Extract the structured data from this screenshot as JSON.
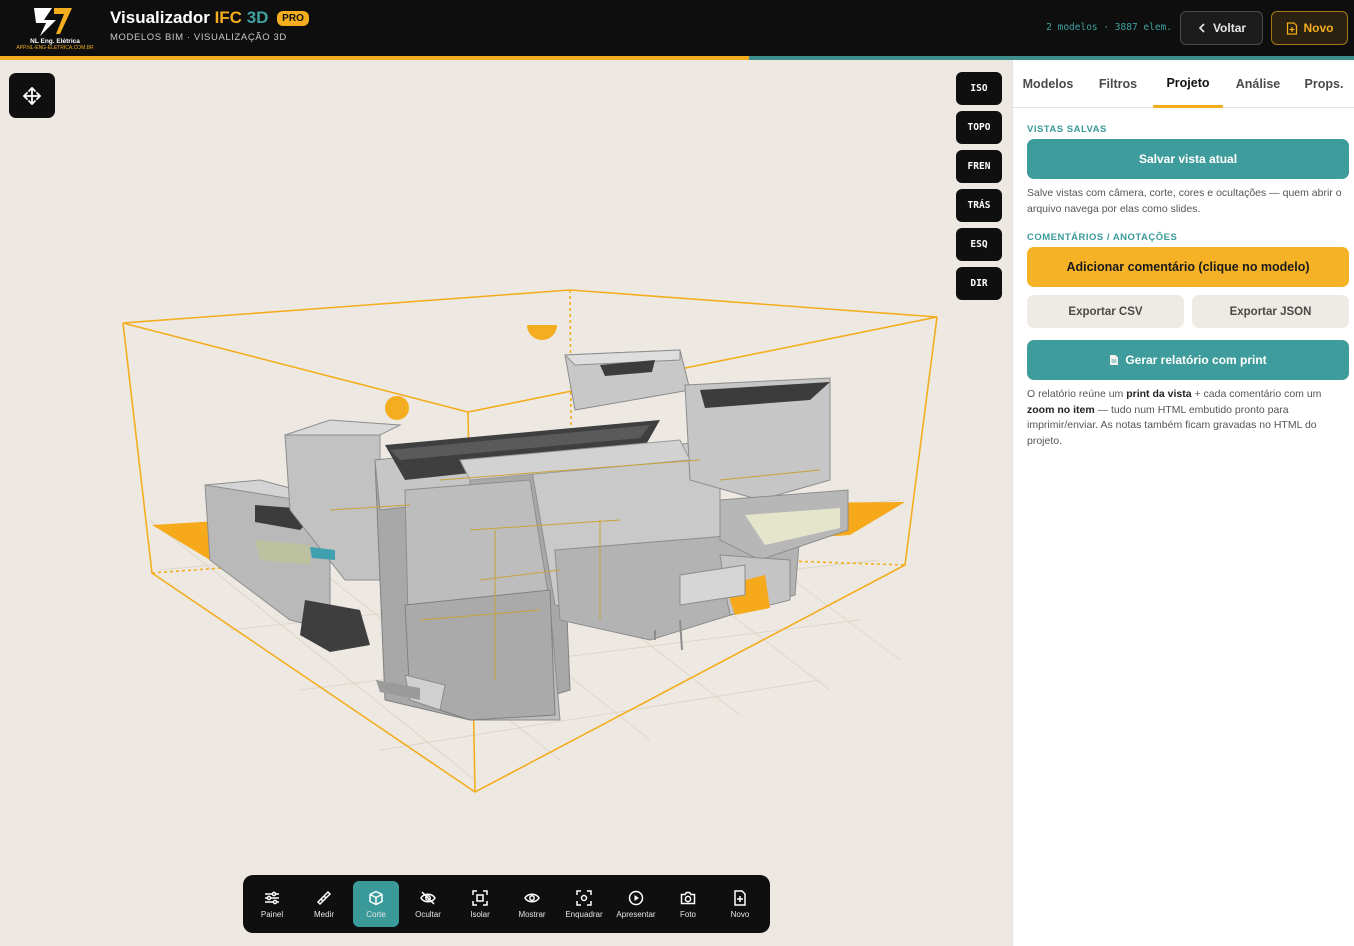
{
  "header": {
    "logo_brand": "NL Eng. Elétrica",
    "logo_url": "APP.NL-ENG-ELETRICA.COM.BR",
    "title_part1": "Visualizador",
    "title_part2": "IFC",
    "title_part3": "3D",
    "badge": "PRO",
    "subtitle": "MODELOS BIM · VISUALIZAÇÃO 3D",
    "stats": "2 modelos · 3887 elem.",
    "back_label": "Voltar",
    "new_label": "Novo",
    "progress_fraction": 0.553
  },
  "view_buttons": [
    "ISO",
    "TOPO",
    "FREN",
    "TRÁS",
    "ESQ",
    "DIR"
  ],
  "toolbar": [
    {
      "label": "Painel",
      "icon": "sliders-icon",
      "active": false
    },
    {
      "label": "Medir",
      "icon": "ruler-icon",
      "active": false
    },
    {
      "label": "Corte",
      "icon": "cube-icon",
      "active": true
    },
    {
      "label": "Ocultar",
      "icon": "eye-off-icon",
      "active": false
    },
    {
      "label": "Isolar",
      "icon": "focus-icon",
      "active": false
    },
    {
      "label": "Mostrar",
      "icon": "eye-icon",
      "active": false
    },
    {
      "label": "Enquadrar",
      "icon": "frame-icon",
      "active": false
    },
    {
      "label": "Apresentar",
      "icon": "play-icon",
      "active": false
    },
    {
      "label": "Foto",
      "icon": "camera-icon",
      "active": false
    },
    {
      "label": "Novo",
      "icon": "file-plus-icon",
      "active": false
    }
  ],
  "panel": {
    "tabs": [
      "Modelos",
      "Filtros",
      "Projeto",
      "Análise",
      "Props."
    ],
    "active_tab": "Projeto",
    "saved_views_title": "VISTAS SALVAS",
    "save_view_button": "Salvar vista atual",
    "saved_views_text": "Salve vistas com câmera, corte, cores e ocultações — quem abrir o arquivo navega por elas como slides.",
    "comments_title": "COMENTÁRIOS / ANOTAÇÕES",
    "add_comment_button": "Adicionar comentário (clique no modelo)",
    "export_csv": "Exportar CSV",
    "export_json": "Exportar JSON",
    "report_button": "Gerar relatório com print",
    "report_text_1": "O relatório reúne um ",
    "report_text_b1": "print da vista",
    "report_text_2": " + cada comentário com um ",
    "report_text_b2": "zoom no item",
    "report_text_3": " — tudo num HTML embutido pronto para imprimir/enviar. As notas também ficam gravadas no HTML do projeto."
  },
  "colors": {
    "accent": "#f3ad1e",
    "teal": "#3f9c9c",
    "header_bg": "#0e0e0e",
    "viewport_bg": "#ede9e2"
  }
}
